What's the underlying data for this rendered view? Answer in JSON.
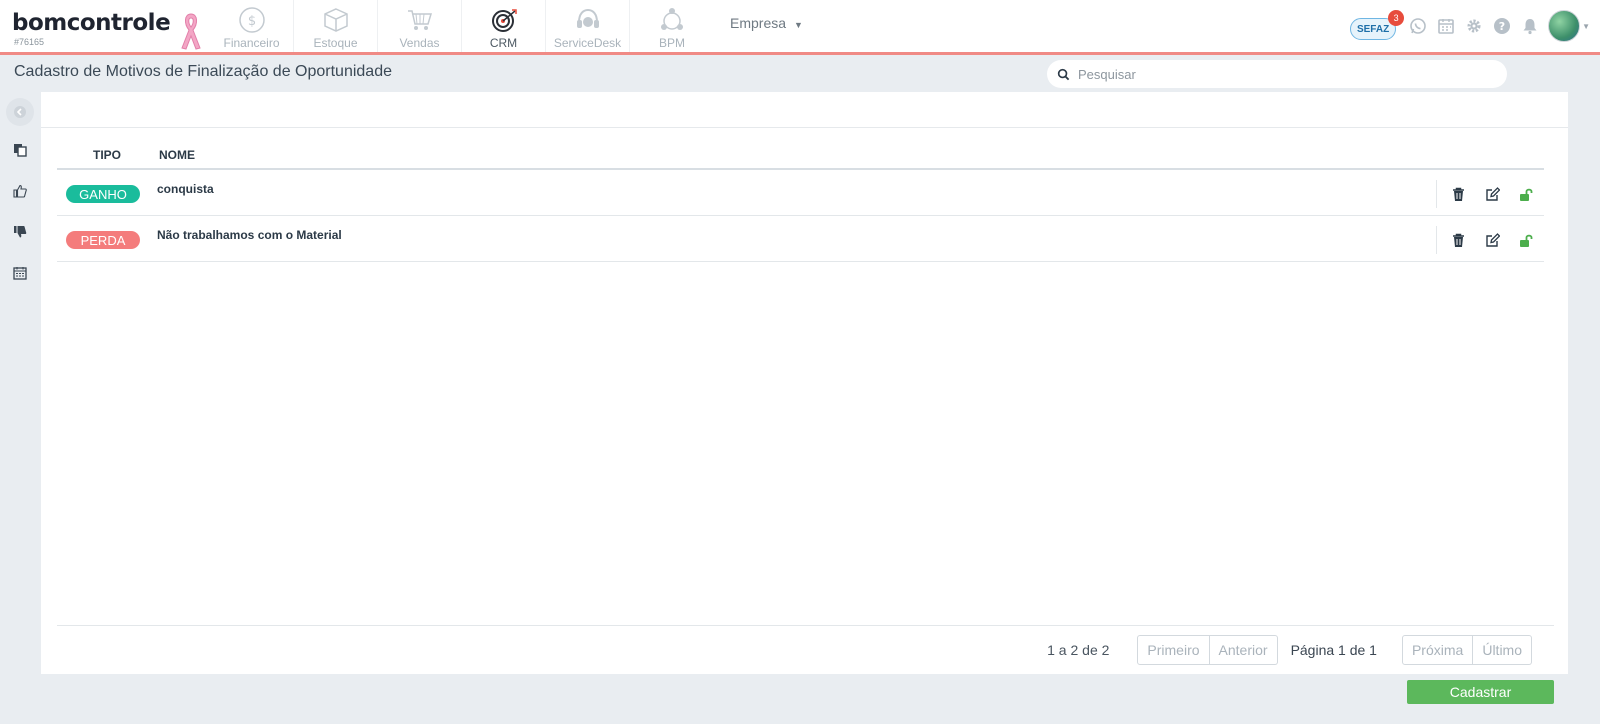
{
  "app": {
    "logo_text": "bomcontrole",
    "account_code": "#76165"
  },
  "modules": [
    {
      "label": "Financeiro",
      "icon": "dollar-circle-icon",
      "active": false
    },
    {
      "label": "Estoque",
      "icon": "box-icon",
      "active": false
    },
    {
      "label": "Vendas",
      "icon": "cart-icon",
      "active": false
    },
    {
      "label": "CRM",
      "icon": "target-icon",
      "active": true
    },
    {
      "label": "ServiceDesk",
      "icon": "headset-icon",
      "active": false
    },
    {
      "label": "BPM",
      "icon": "process-icon",
      "active": false
    }
  ],
  "company_menu": {
    "label": "Empresa",
    "caret": "▼"
  },
  "top_right": {
    "sefaz_label": "SEFAZ",
    "sefaz_badge": "3",
    "icons": [
      "whatsapp-icon",
      "calendar-icon",
      "gear-icon",
      "help-icon",
      "bell-icon",
      "avatar"
    ]
  },
  "page": {
    "title": "Cadastro de Motivos de Finalização de Oportunidade"
  },
  "search": {
    "placeholder": "Pesquisar",
    "value": ""
  },
  "sidebar": {
    "items": [
      "copy-icon",
      "thumbs-up-icon",
      "thumbs-down-icon",
      "calendar-icon"
    ]
  },
  "table": {
    "columns": {
      "tipo": "TIPO",
      "nome": "NOME"
    },
    "rows": [
      {
        "tipo": "GANHO",
        "tipo_color": "#1abc9c",
        "nome": "conquista"
      },
      {
        "tipo": "PERDA",
        "tipo_color": "#f47c7c",
        "nome": "Não trabalhamos com o Material"
      }
    ]
  },
  "pagination": {
    "count": "1 a 2 de 2",
    "first": "Primeiro",
    "previous": "Anterior",
    "page_info": "Página 1 de 1",
    "next": "Próxima",
    "last": "Último"
  },
  "actions": {
    "submit": "Cadastrar"
  },
  "colors": {
    "accent_line": "#f08a85",
    "ganho": "#1abc9c",
    "perda": "#f47c7c",
    "submit": "#5cb85c"
  }
}
